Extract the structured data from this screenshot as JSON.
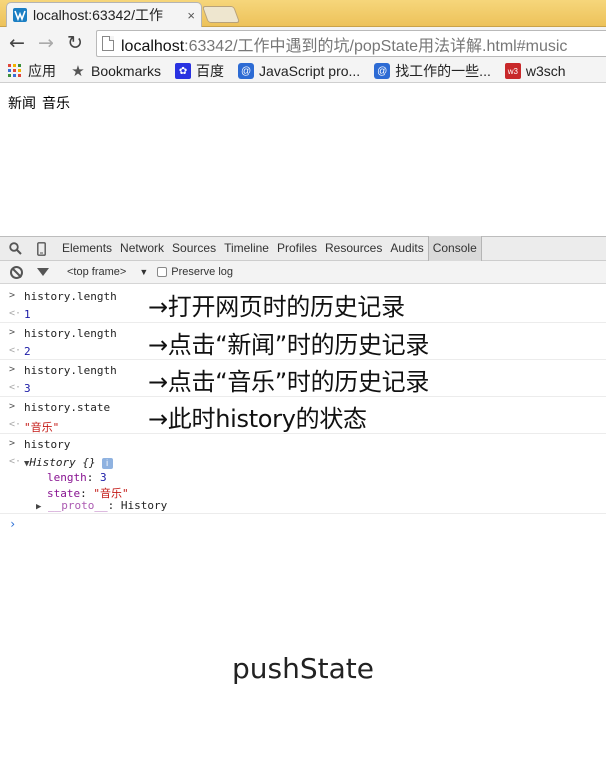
{
  "browser": {
    "tab_title": "localhost:63342/工作",
    "tab_close": "×",
    "url_host": "localhost",
    "url_rest": ":63342/工作中遇到的坑/popState用法详解.html#music"
  },
  "bookmarks": [
    {
      "label": "应用",
      "icon": "apps-grid-icon"
    },
    {
      "label": "Bookmarks",
      "icon": "star-icon"
    },
    {
      "label": "百度",
      "icon": "baidu-paw-icon"
    },
    {
      "label": "JavaScript pro...",
      "icon": "bookmark-site-icon"
    },
    {
      "label": "找工作的一些...",
      "icon": "bookmark-site-icon"
    },
    {
      "label": "w3sch",
      "icon": "w3-icon"
    }
  ],
  "page": {
    "link_news": "新闻",
    "link_music": "音乐"
  },
  "devtools": {
    "tabs": [
      "Elements",
      "Network",
      "Sources",
      "Timeline",
      "Profiles",
      "Resources",
      "Audits",
      "Console"
    ],
    "active_tab": "Console",
    "frame_selector": "<top frame>",
    "preserve_log": "Preserve log"
  },
  "console": {
    "entries": [
      {
        "command": "history.length",
        "result": "1",
        "note": "→打开网页时的历史记录"
      },
      {
        "command": "history.length",
        "result": "2",
        "note": "→点击“新闻”时的历史记录"
      },
      {
        "command": "history.length",
        "result": "3",
        "note": "→点击“音乐”时的历史记录"
      },
      {
        "command": "history.state",
        "result": "\"音乐\"",
        "note": "→此时history的状态"
      }
    ],
    "history_cmd": "history",
    "history_obj": {
      "header": "History {}",
      "info": "i",
      "length_key": "length",
      "length_val": "3",
      "state_key": "state",
      "state_val": "\"音乐\"",
      "proto_key": "__proto__",
      "proto_val": "History"
    }
  },
  "caption": "pushState"
}
